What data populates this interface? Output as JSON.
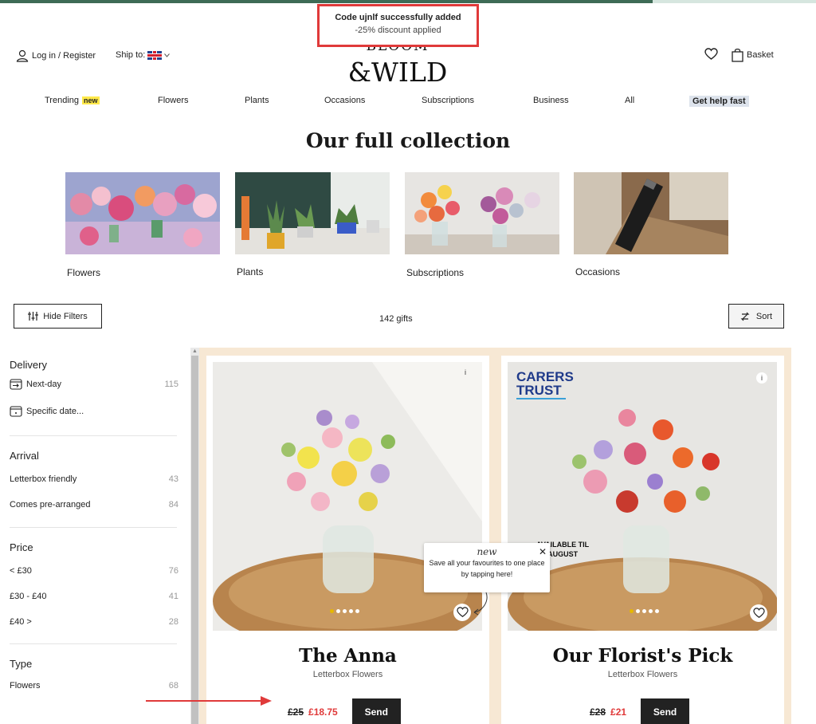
{
  "progress": {
    "fraction": 0.8
  },
  "toast": {
    "line1": "Code ujnlf successfully added",
    "line2": "-25% discount applied"
  },
  "header": {
    "login": "Log in / Register",
    "ship_to": "Ship to:",
    "logo_line1": "BLOOM",
    "logo_line2": "&WILD",
    "basket": "Basket"
  },
  "nav": {
    "items": [
      "Trending",
      "Flowers",
      "Plants",
      "Occasions",
      "Subscriptions",
      "Business",
      "All",
      "Get help fast"
    ],
    "trending_badge": "new"
  },
  "page_title": "Our full collection",
  "categories": [
    "Flowers",
    "Plants",
    "Subscriptions",
    "Occasions"
  ],
  "toolbar": {
    "hide_filters": "Hide Filters",
    "count": "142 gifts",
    "sort": "Sort"
  },
  "filters": {
    "delivery": {
      "title": "Delivery",
      "next_day": "Next-day",
      "next_day_count": "115",
      "specific_date": "Specific date..."
    },
    "arrival": {
      "title": "Arrival",
      "items": [
        {
          "label": "Letterbox friendly",
          "count": "43"
        },
        {
          "label": "Comes pre-arranged",
          "count": "84"
        }
      ]
    },
    "price": {
      "title": "Price",
      "items": [
        {
          "label": "< £30",
          "count": "76"
        },
        {
          "label": "£30 - £40",
          "count": "41"
        },
        {
          "label": "£40 >",
          "count": "28"
        }
      ]
    },
    "type": {
      "title": "Type",
      "items": [
        {
          "label": "Flowers",
          "count": "68"
        }
      ]
    }
  },
  "products": [
    {
      "name": "The Anna",
      "subtitle": "Letterbox Flowers",
      "old_price": "£25",
      "new_price": "£18.75",
      "cta": "Send"
    },
    {
      "name": "Our Florist's Pick",
      "subtitle": "Letterbox Flowers",
      "old_price": "£28",
      "new_price": "£21",
      "cta": "Send",
      "badge_line1": "CARERS",
      "badge_line2": "TRUST",
      "overlay_text1": "AVAILABLE TIL",
      "overlay_text2": "TH AUGUST"
    }
  ],
  "tooltip": {
    "heading": "new",
    "text": "Save all your favourites to one place by tapping here!"
  },
  "colors": {
    "accent": "#3e6b56",
    "sale": "#e03a3a",
    "highlight": "#ffe94a",
    "panel": "#f7e8d4"
  }
}
